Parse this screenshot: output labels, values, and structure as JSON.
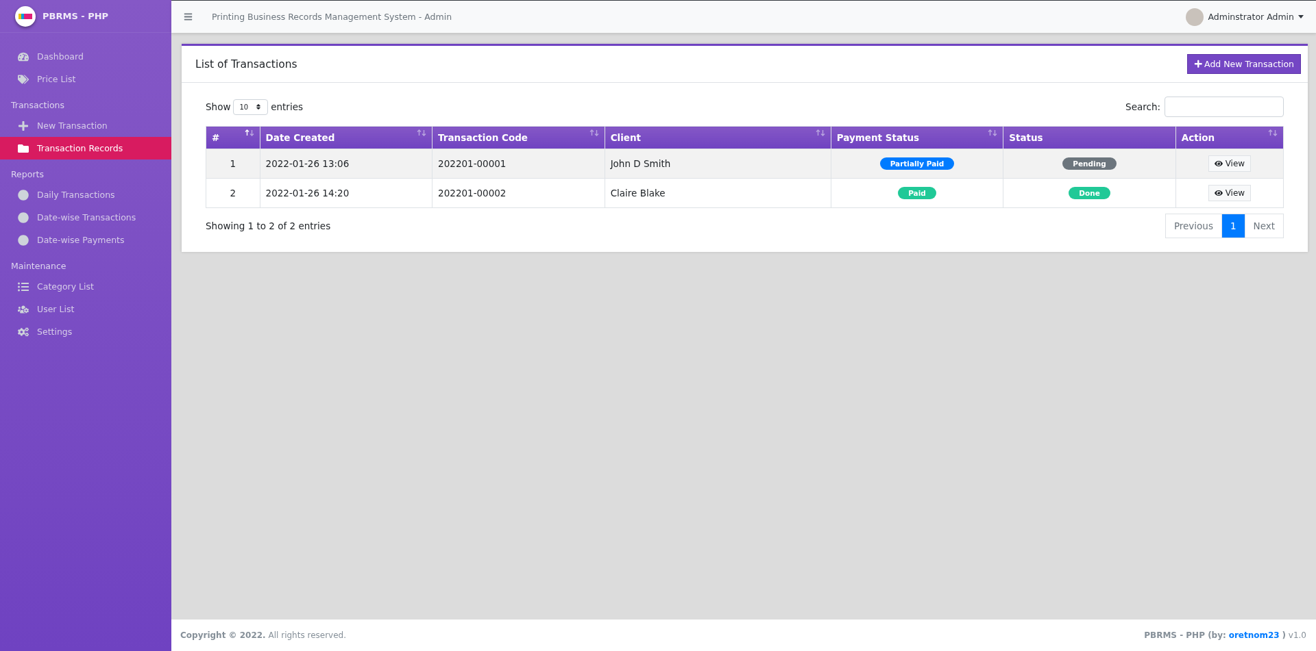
{
  "brand": {
    "title": "PBRMS - PHP"
  },
  "sidebar": {
    "sections": [
      {
        "items": [
          {
            "label": "Dashboard",
            "selected": false
          },
          {
            "label": "Price List",
            "selected": false
          }
        ]
      },
      {
        "heading": "Transactions",
        "items": [
          {
            "label": "New Transaction",
            "selected": false
          },
          {
            "label": "Transaction Records",
            "selected": true
          }
        ]
      },
      {
        "heading": "Reports",
        "items": [
          {
            "label": "Daily Transactions",
            "selected": false
          },
          {
            "label": "Date-wise Transactions",
            "selected": false
          },
          {
            "label": "Date-wise Payments",
            "selected": false
          }
        ]
      },
      {
        "heading": "Maintenance",
        "items": [
          {
            "label": "Category List",
            "selected": false
          },
          {
            "label": "User List",
            "selected": false
          },
          {
            "label": "Settings",
            "selected": false
          }
        ]
      }
    ]
  },
  "topbar": {
    "title": "Printing Business Records Management System - Admin",
    "user": "Adminstrator Admin"
  },
  "card": {
    "title": "List of Transactions",
    "add_button": "Add New Transaction"
  },
  "table_controls": {
    "show_label": "Show",
    "page_size": "10",
    "entries_label": "entries",
    "search_label": "Search:"
  },
  "table": {
    "columns": [
      {
        "label": "#",
        "sortable": true,
        "sorted": true
      },
      {
        "label": "Date Created",
        "sortable": true,
        "sorted": false
      },
      {
        "label": "Transaction Code",
        "sortable": true,
        "sorted": false
      },
      {
        "label": "Client",
        "sortable": true,
        "sorted": false
      },
      {
        "label": "Payment Status",
        "sortable": true,
        "sorted": false
      },
      {
        "label": "Status",
        "sortable": false
      },
      {
        "label": "Action",
        "sortable": true,
        "sorted": false
      }
    ],
    "rows": [
      {
        "no": "1",
        "date": "2022-01-26 13:06",
        "code": "202201-00001",
        "client": "John D Smith",
        "payment": {
          "text": "Partially Paid",
          "color": "#007bff"
        },
        "status": {
          "text": "Pending",
          "color": "#6c757d"
        },
        "action": "View"
      },
      {
        "no": "2",
        "date": "2022-01-26 14:20",
        "code": "202201-00002",
        "client": "Claire Blake",
        "payment": {
          "text": "Paid",
          "color": "#20c997"
        },
        "status": {
          "text": "Done",
          "color": "#20c997"
        },
        "action": "View"
      }
    ]
  },
  "table_info": "Showing 1 to 2 of 2 entries",
  "pagination": [
    {
      "label": "Previous",
      "selected": false
    },
    {
      "label": "1",
      "selected": true
    },
    {
      "label": "Next",
      "selected": false
    }
  ],
  "footer": {
    "left": "**Copyright © 2022.** All rights reserved.",
    "right_before": "**PBRMS - PHP (by:**",
    "link": "oretnom23",
    "right_after": "**)** v1.0"
  }
}
